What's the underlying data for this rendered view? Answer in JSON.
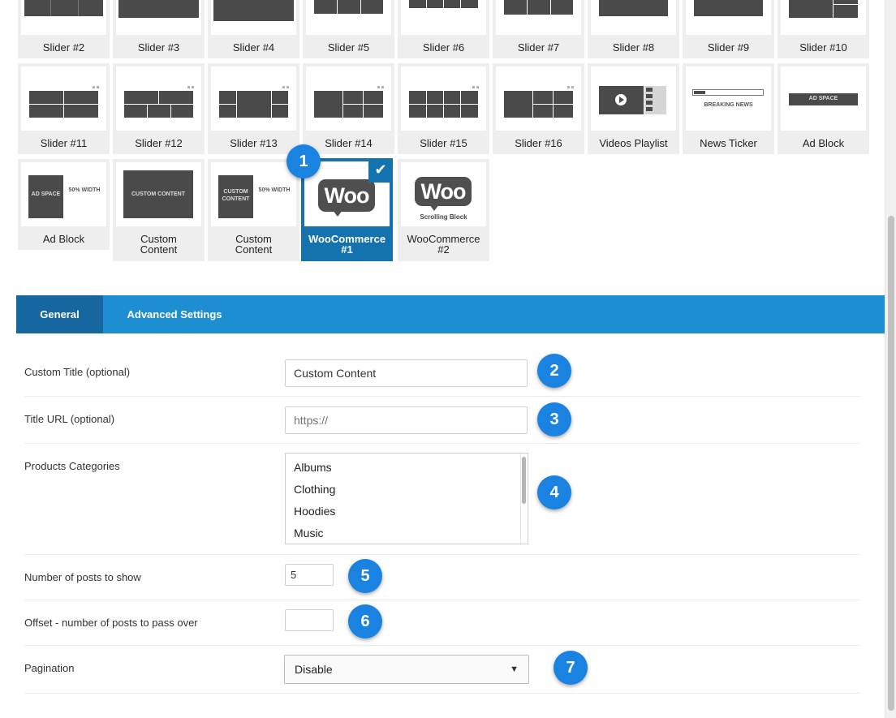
{
  "blocks": {
    "row1": [
      "Slider #2",
      "Slider #3",
      "Slider #4",
      "Slider #5",
      "Slider #6",
      "Slider #7",
      "Slider #8",
      "Slider #9",
      "Slider #10"
    ],
    "row2": [
      "Slider #11",
      "Slider #12",
      "Slider #13",
      "Slider #14",
      "Slider #15",
      "Slider #16",
      "Videos Playlist",
      "News Ticker",
      "Ad Block"
    ],
    "row3": [
      "Ad Block",
      "Custom Content",
      "Custom Content",
      "WooCommerce #1",
      "WooCommerce #2"
    ],
    "selected": "WooCommerce #1",
    "thumb_text": {
      "breaking_news": "BREAKING NEWS",
      "ad_space": "AD SPACE",
      "half_width": "50% WIDTH",
      "custom_content": "CUSTOM CONTENT",
      "custom_content_short": "CUSTOM CONTENT",
      "woo": "Woo",
      "scrolling_block": "Scrolling Block"
    }
  },
  "callouts": [
    "1",
    "2",
    "3",
    "4",
    "5",
    "6",
    "7"
  ],
  "tabs": [
    {
      "label": "General",
      "active": true
    },
    {
      "label": "Advanced Settings",
      "active": false
    }
  ],
  "form": {
    "custom_title": {
      "label": "Custom Title (optional)",
      "value": "Custom Content"
    },
    "title_url": {
      "label": "Title URL (optional)",
      "placeholder": "https://"
    },
    "products_categories": {
      "label": "Products Categories",
      "options": [
        "Albums",
        "Clothing",
        "Hoodies",
        "Music"
      ]
    },
    "posts_count": {
      "label": "Number of posts to show",
      "value": "5"
    },
    "offset": {
      "label": "Offset - number of posts to pass over",
      "value": ""
    },
    "pagination": {
      "label": "Pagination",
      "selected": "Disable"
    }
  },
  "colors": {
    "accent": "#1e8ed3",
    "active_tab": "#1666a0",
    "selected_tile": "#1473ae",
    "badge": "#1a82e0"
  },
  "icons": {
    "check": "check-icon",
    "caret": "caret-down-icon",
    "play": "play-icon"
  }
}
